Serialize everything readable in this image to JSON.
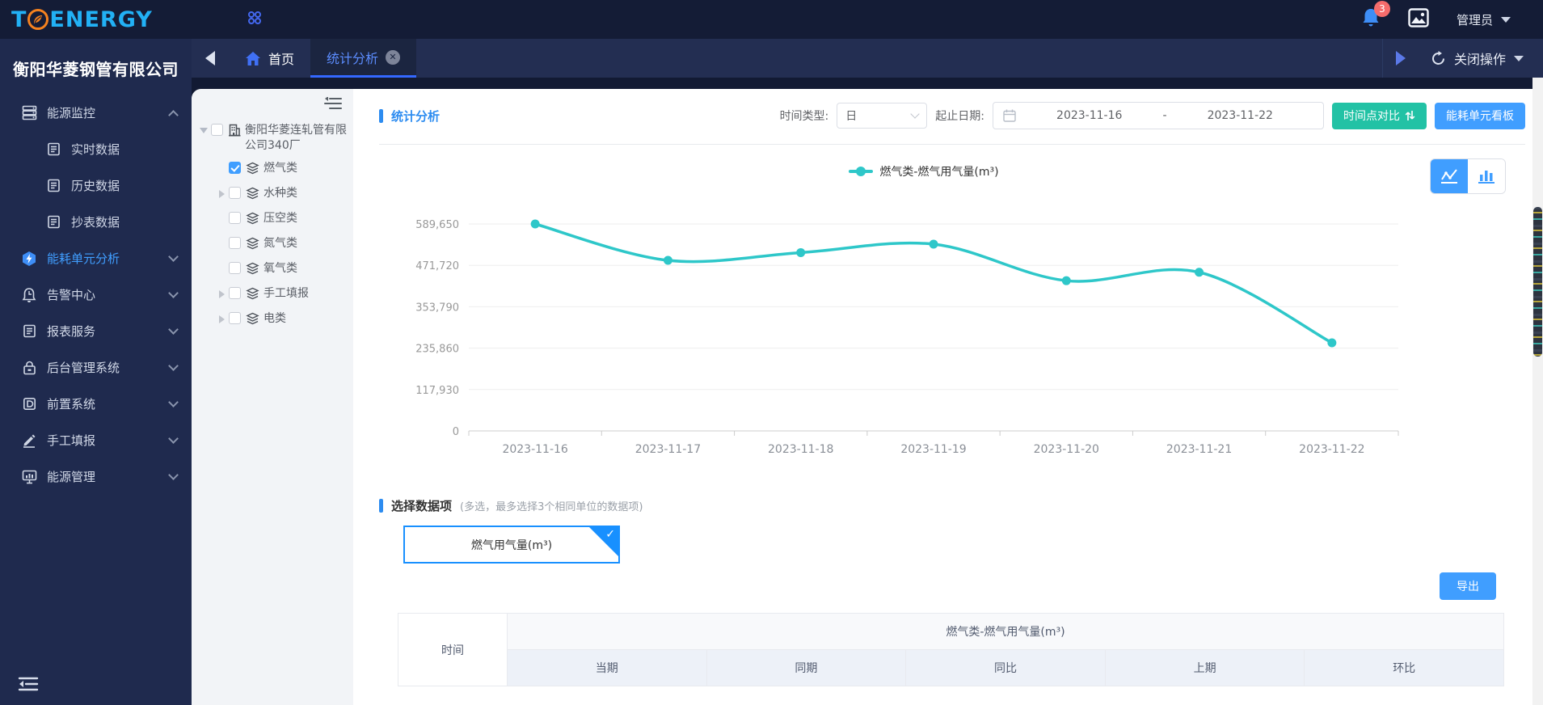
{
  "header": {
    "logo_t": "T",
    "logo_rest": "ENERGY",
    "notification_count": "3",
    "user_name": "管理员"
  },
  "sidebar": {
    "company_name": "衡阳华菱钢管有限公司",
    "items": [
      {
        "label": "能源监控",
        "icon": "server-icon",
        "expanded": true,
        "children": [
          "实时数据",
          "历史数据",
          "抄表数据"
        ]
      },
      {
        "label": "能耗单元分析",
        "icon": "hex-bolt-icon",
        "active": true
      },
      {
        "label": "告警中心",
        "icon": "alarm-icon"
      },
      {
        "label": "报表服务",
        "icon": "report-icon"
      },
      {
        "label": "后台管理系统",
        "icon": "lock-icon"
      },
      {
        "label": "前置系统",
        "icon": "front-icon"
      },
      {
        "label": "手工填报",
        "icon": "pencil-icon"
      },
      {
        "label": "能源管理",
        "icon": "monitor-icon"
      }
    ]
  },
  "tabs": {
    "home_label": "首页",
    "active_label": "统计分析",
    "close_ops_label": "关闭操作"
  },
  "tree": {
    "root": {
      "label": "衡阳华菱连轧管有限公司340厂",
      "checked": false,
      "expanded": true
    },
    "items": [
      {
        "label": "燃气类",
        "checked": true,
        "caret": false
      },
      {
        "label": "水种类",
        "checked": false,
        "caret": true
      },
      {
        "label": "压空类",
        "checked": false,
        "caret": false
      },
      {
        "label": "氮气类",
        "checked": false,
        "caret": false
      },
      {
        "label": "氧气类",
        "checked": false,
        "caret": false
      },
      {
        "label": "手工填报",
        "checked": false,
        "caret": true
      },
      {
        "label": "电类",
        "checked": false,
        "caret": true
      }
    ]
  },
  "section": {
    "title": "统计分析"
  },
  "filters": {
    "time_type_label": "时间类型:",
    "time_type_value": "日",
    "date_label": "起止日期:",
    "date_start": "2023-11-16",
    "date_separator": "-",
    "date_end": "2023-11-22",
    "compare_button": "时间点对比",
    "board_button": "能耗单元看板"
  },
  "chart_data": {
    "type": "line",
    "title": "",
    "legend": [
      "燃气类-燃气用气量(m³)"
    ],
    "legend_position": "top-center",
    "categories": [
      "2023-11-16",
      "2023-11-17",
      "2023-11-18",
      "2023-11-19",
      "2023-11-20",
      "2023-11-21",
      "2023-11-22"
    ],
    "series": [
      {
        "name": "燃气类-燃气用气量(m³)",
        "values": [
          589650,
          486000,
          508000,
          532000,
          428000,
          452000,
          251000
        ]
      }
    ],
    "ylim": [
      0,
      589650
    ],
    "yticks": [
      0,
      117930,
      235860,
      353790,
      471720,
      589650
    ],
    "ytick_labels": [
      "0",
      "117,930",
      "235,860",
      "353,790",
      "471,720",
      "589,650"
    ],
    "grid": true,
    "smooth": true,
    "line_color": "#2ec7c9"
  },
  "data_picker": {
    "title": "选择数据项",
    "hint": "(多选，最多选择3个相同单位的数据项)",
    "chips": [
      {
        "label": "燃气用气量(m³)",
        "selected": true
      }
    ]
  },
  "export_button": "导出",
  "table": {
    "time_header": "时间",
    "group_header": "燃气类-燃气用气量(m³)",
    "sub_headers": [
      "当期",
      "同期",
      "同比",
      "上期",
      "环比"
    ]
  },
  "colors": {
    "accent_blue": "#409eff",
    "title_blue": "#2d8cf0",
    "teal_button": "#22c2a5",
    "chart_line": "#2ec7c9",
    "badge_red": "#f56c6c",
    "sidebar_bg": "#1f2a4e",
    "topbar_bg": "#141c36"
  }
}
